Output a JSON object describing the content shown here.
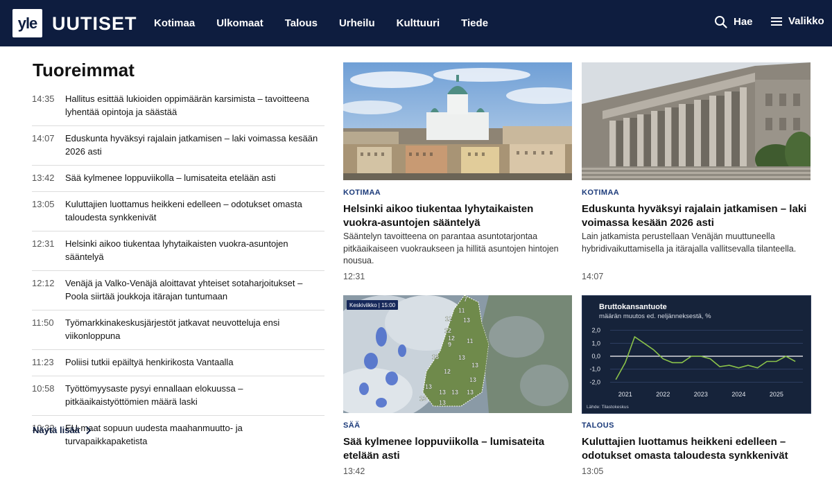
{
  "header": {
    "logo": "yle",
    "brand": "UUTISET",
    "nav": [
      "Kotimaa",
      "Ulkomaat",
      "Talous",
      "Urheilu",
      "Kulttuuri",
      "Tiede"
    ],
    "search_label": "Hae",
    "menu_label": "Valikko"
  },
  "latest": {
    "title": "Tuoreimmat",
    "items": [
      {
        "time": "14:35",
        "title": "Hallitus esittää lukioiden oppimäärän karsimista – tavoitteena lyhentää opintoja ja säästää"
      },
      {
        "time": "14:07",
        "title": "Eduskunta hyväksyi rajalain jatkamisen – laki voimassa kesään 2026 asti"
      },
      {
        "time": "13:42",
        "title": "Sää kylmenee loppuviikolla – lumisateita etelään asti"
      },
      {
        "time": "13:05",
        "title": "Kuluttajien luottamus heikkeni edelleen – odotukset omasta taloudesta synkkenivät"
      },
      {
        "time": "12:31",
        "title": "Helsinki aikoo tiukentaa lyhytaikaisten vuokra-asuntojen sääntelyä"
      },
      {
        "time": "12:12",
        "title": "Venäjä ja Valko-Venäjä aloittavat yhteiset sotaharjoitukset – Poola siirtää joukkoja itärajan tuntumaan"
      },
      {
        "time": "11:50",
        "title": "Työmarkkinakeskusjärjestöt jatkavat neuvotteluja ensi viikonloppuna"
      },
      {
        "time": "11:23",
        "title": "Poliisi tutkii epäiltyä henkirikosta Vantaalla"
      },
      {
        "time": "10:58",
        "title": "Työttömyysaste pysyi ennallaan elokuussa – pitkäaikaistyöttömien määrä laski"
      },
      {
        "time": "10:32",
        "title": "EU-maat sopuun uudesta maahanmuutto- ja turvapaikkapaketista"
      }
    ],
    "more_label": "Näytä lisää"
  },
  "cards": [
    {
      "category": "KOTIMAA",
      "title": "Helsinki aikoo tiukentaa lyhytaikaisten vuokra-asuntojen sääntelyä",
      "lead": "Sääntelyn tavoitteena on parantaa asuntotarjontaa pitkäaikaiseen vuokraukseen ja hillitä asuntojen hintojen nousua.",
      "time": "12:31"
    },
    {
      "category": "KOTIMAA",
      "title": "Eduskunta hyväksyi rajalain jatkamisen – laki voimassa kesään 2026 asti",
      "lead": "Lain jatkamista perustellaan Venäjän muuttuneella hybridivaikuttamisella ja itärajalla vallitsevalla tilanteella.",
      "time": "14:07"
    },
    {
      "category": "SÄÄ",
      "title": "Sää kylmenee loppuviikolla – lumisateita etelään asti",
      "time": "13:42",
      "map_badge": "Keskiviikko | 15:00",
      "map_temps": [
        "7",
        "11",
        "12",
        "13",
        "12",
        "9",
        "11",
        "12",
        "13",
        "13",
        "12",
        "13",
        "13",
        "13",
        "13",
        "13",
        "13",
        "13",
        "13"
      ]
    },
    {
      "category": "TALOUS",
      "title": "Kuluttajien luottamus heikkeni edelleen – odotukset omasta taloudesta synkkenivät",
      "time": "13:05"
    }
  ],
  "chart_data": {
    "type": "line",
    "title": "Bruttokansantuote",
    "subtitle": "määrän muutos ed. neljänneksestä, %",
    "source": "Lähde: Tilastokeskus",
    "x": [
      2020.75,
      2021.0,
      2021.25,
      2021.5,
      2021.75,
      2022.0,
      2022.25,
      2022.5,
      2022.75,
      2023.0,
      2023.25,
      2023.5,
      2023.75,
      2024.0,
      2024.25,
      2024.5,
      2024.75,
      2025.0,
      2025.25,
      2025.5
    ],
    "values": [
      -1.8,
      -0.5,
      1.5,
      1.0,
      0.5,
      -0.2,
      -0.5,
      -0.5,
      0.0,
      0.0,
      -0.2,
      -0.8,
      -0.7,
      -0.9,
      -0.7,
      -0.9,
      -0.4,
      -0.4,
      0.0,
      -0.4
    ],
    "xticks": [
      "2021",
      "2022",
      "2023",
      "2024",
      "2025"
    ],
    "xtick_values": [
      2021,
      2022,
      2023,
      2024,
      2025
    ],
    "yticks": [
      "2,0",
      "1,0",
      "0,0",
      "-1,0",
      "-2,0"
    ],
    "ytick_values": [
      2,
      1,
      0,
      -1,
      -2
    ],
    "xlim": [
      2020.6,
      2025.7
    ],
    "ylim": [
      -2.3,
      2.3
    ],
    "line_color": "#8bc34a",
    "grid": "horizontal"
  },
  "colors": {
    "header_bg": "#0e1d3f",
    "category": "#1b3a7a",
    "chart_bg": "#16233a"
  }
}
